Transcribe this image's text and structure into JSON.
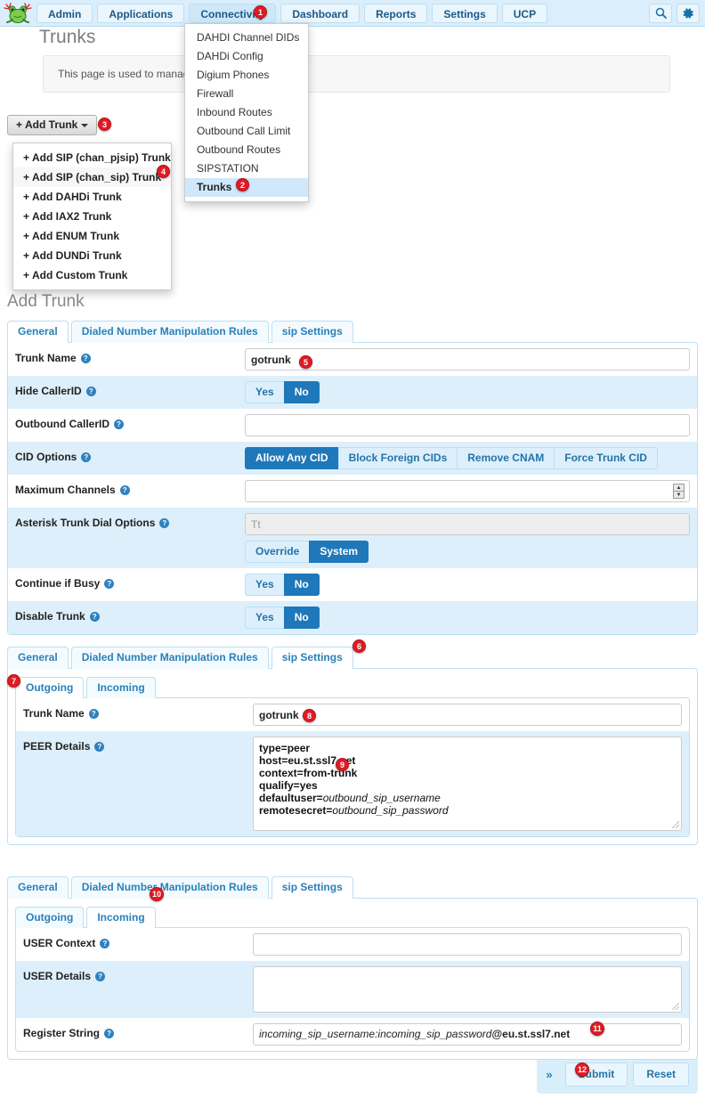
{
  "app": {
    "logo_name": "freepbx-frog-logo",
    "nav_items": [
      {
        "label": "Admin",
        "active": false
      },
      {
        "label": "Applications",
        "active": false
      },
      {
        "label": "Connectivity",
        "active": true
      },
      {
        "label": "Dashboard",
        "active": false
      },
      {
        "label": "Reports",
        "active": false
      },
      {
        "label": "Settings",
        "active": false
      },
      {
        "label": "UCP",
        "active": false
      }
    ],
    "search_icon": "search-icon",
    "gear_icon": "gear-icon"
  },
  "connectivity_menu": {
    "items": [
      {
        "label": "DAHDI Channel DIDs",
        "selected": false
      },
      {
        "label": "DAHDi Config",
        "selected": false
      },
      {
        "label": "Digium Phones",
        "selected": false
      },
      {
        "label": "Firewall",
        "selected": false
      },
      {
        "label": "Inbound Routes",
        "selected": false
      },
      {
        "label": "Outbound Call Limit",
        "selected": false
      },
      {
        "label": "Outbound Routes",
        "selected": false
      },
      {
        "label": "SIPSTATION",
        "selected": false
      },
      {
        "label": "Trunks",
        "selected": true
      }
    ]
  },
  "page": {
    "title": "Trunks",
    "info_text": "This page is used to manag"
  },
  "add_trunk": {
    "button_label": "Add Trunk",
    "menu_items": [
      {
        "label": "Add SIP (chan_pjsip) Trunk",
        "hover": false
      },
      {
        "label": "Add SIP (chan_sip) Trunk",
        "hover": true
      },
      {
        "label": "Add DAHDi Trunk",
        "hover": false
      },
      {
        "label": "Add IAX2 Trunk",
        "hover": false
      },
      {
        "label": "Add ENUM Trunk",
        "hover": false
      },
      {
        "label": "Add DUNDi Trunk",
        "hover": false
      },
      {
        "label": "Add Custom Trunk",
        "hover": false
      }
    ]
  },
  "form": {
    "heading": "Add Trunk",
    "tabs": [
      {
        "label": "General"
      },
      {
        "label": "Dialed Number Manipulation Rules"
      },
      {
        "label": "sip Settings"
      }
    ],
    "subtabs": [
      {
        "label": "Outgoing"
      },
      {
        "label": "Incoming"
      }
    ]
  },
  "general": {
    "trunk_name_label": "Trunk Name",
    "trunk_name_value": "gotrunk",
    "hide_callerid_label": "Hide CallerID",
    "hide_callerid_options": [
      "Yes",
      "No"
    ],
    "hide_callerid_selected": "No",
    "outbound_callerid_label": "Outbound CallerID",
    "outbound_callerid_value": "",
    "cid_options_label": "CID Options",
    "cid_options": [
      "Allow Any CID",
      "Block Foreign CIDs",
      "Remove CNAM",
      "Force Trunk CID"
    ],
    "cid_options_selected": "Allow Any CID",
    "maximum_channels_label": "Maximum Channels",
    "maximum_channels_value": "",
    "dial_options_label": "Asterisk Trunk Dial Options",
    "dial_options_value": "Tt",
    "dial_options_modes": [
      "Override",
      "System"
    ],
    "dial_options_selected": "System",
    "continue_if_busy_label": "Continue if Busy",
    "continue_if_busy_options": [
      "Yes",
      "No"
    ],
    "continue_if_busy_selected": "No",
    "disable_trunk_label": "Disable Trunk",
    "disable_trunk_options": [
      "Yes",
      "No"
    ],
    "disable_trunk_selected": "No"
  },
  "outgoing": {
    "trunk_name_label": "Trunk Name",
    "trunk_name_value": "gotrunk",
    "peer_details_label": "PEER Details",
    "peer_details_lines": [
      {
        "key": "type=",
        "value": "peer",
        "italic": false
      },
      {
        "key": "host=",
        "value": "eu.st.ssl7.net",
        "italic": false
      },
      {
        "key": "context=",
        "value": "from-trunk",
        "italic": false
      },
      {
        "key": "qualify=",
        "value": "yes",
        "italic": false
      },
      {
        "key": "defaultuser=",
        "value": "outbound_sip_username",
        "italic": true
      },
      {
        "key": "remotesecret=",
        "value": "outbound_sip_password",
        "italic": true
      }
    ]
  },
  "incoming": {
    "user_context_label": "USER Context",
    "user_context_value": "",
    "user_details_label": "USER Details",
    "user_details_value": "",
    "register_string_label": "Register String",
    "register_string_italic": "incoming_sip_username:incoming_sip_password",
    "register_string_bold": "@eu.st.ssl7.net"
  },
  "footer": {
    "chevron": "»",
    "submit_label": "Submit",
    "reset_label": "Reset"
  },
  "badges": [
    {
      "n": "1"
    },
    {
      "n": "2"
    },
    {
      "n": "3"
    },
    {
      "n": "4"
    },
    {
      "n": "5"
    },
    {
      "n": "6"
    },
    {
      "n": "7"
    },
    {
      "n": "8"
    },
    {
      "n": "9"
    },
    {
      "n": "10"
    },
    {
      "n": "11"
    },
    {
      "n": "12"
    }
  ],
  "colors": {
    "nav_bg": "#daeefc",
    "accent_blue": "#1f78b9",
    "link_blue": "#2980b9",
    "row_stripe": "#ddeffb",
    "badge_red": "#e01b24"
  }
}
